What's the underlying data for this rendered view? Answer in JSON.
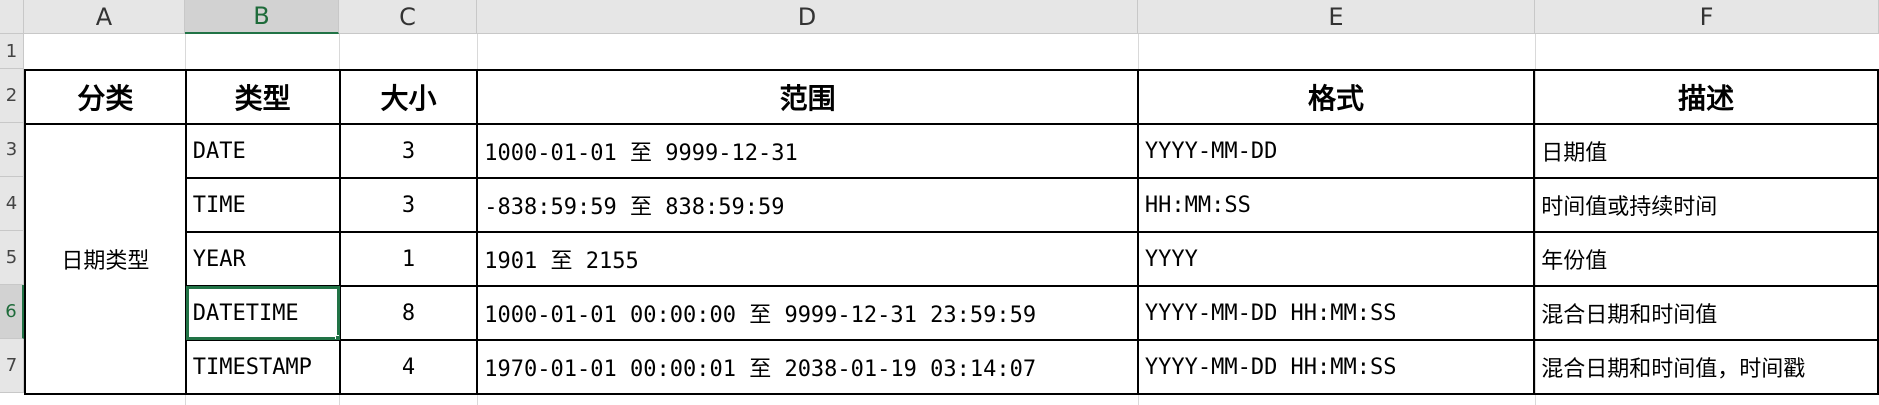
{
  "columns": [
    "A",
    "B",
    "C",
    "D",
    "E",
    "F"
  ],
  "rows": [
    "1",
    "2",
    "3",
    "4",
    "5",
    "6",
    "7"
  ],
  "selected_column": "B",
  "selected_row": "6",
  "table": {
    "headers": [
      "分类",
      "类型",
      "大小",
      "范围",
      "格式",
      "描述"
    ],
    "category": "日期类型",
    "records": [
      {
        "type": "DATE",
        "size": "3",
        "range": "1000-01-01 至 9999-12-31",
        "format": "YYYY-MM-DD",
        "desc": "日期值"
      },
      {
        "type": "TIME",
        "size": "3",
        "range": "-838:59:59 至 838:59:59",
        "format": "HH:MM:SS",
        "desc": "时间值或持续时间"
      },
      {
        "type": "YEAR",
        "size": "1",
        "range": "1901 至 2155",
        "format": "YYYY",
        "desc": "年份值"
      },
      {
        "type": "DATETIME",
        "size": "8",
        "range": "1000-01-01 00:00:00 至 9999-12-31 23:59:59",
        "format": "YYYY-MM-DD HH:MM:SS",
        "desc": "混合日期和时间值"
      },
      {
        "type": "TIMESTAMP",
        "size": "4",
        "range": "1970-01-01 00:00:01 至 2038-01-19 03:14:07",
        "format": "YYYY-MM-DD HH:MM:SS",
        "desc": "混合日期和时间值，时间戳"
      }
    ]
  },
  "colors": {
    "selection": "#217346",
    "header_bg": "#e6e6e6"
  }
}
